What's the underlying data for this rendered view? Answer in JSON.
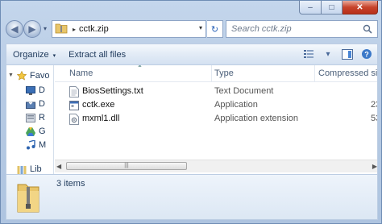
{
  "window": {
    "min_glyph": "–",
    "max_glyph": "□",
    "close_glyph": "✕"
  },
  "nav": {
    "back_glyph": "◀",
    "forward_glyph": "▶",
    "recent_glyph": "▾",
    "breadcrumb": [
      "cctk.zip"
    ],
    "crumb_separator": "▸",
    "dropdown_glyph": "▾",
    "refresh_glyph": "↻",
    "search_placeholder": "Search cctk.zip"
  },
  "toolbar": {
    "organize_label": "Organize",
    "extract_label": "Extract all files",
    "caret": "▾"
  },
  "navpane": {
    "items": [
      {
        "label": "Favo",
        "icon": "star-icon"
      },
      {
        "label": "D",
        "icon": "desktop-icon"
      },
      {
        "label": "D",
        "icon": "downloads-icon"
      },
      {
        "label": "R",
        "icon": "recent-places-icon"
      },
      {
        "label": "G",
        "icon": "google-drive-icon"
      },
      {
        "label": "M",
        "icon": "music-icon"
      },
      {
        "label": "Lib",
        "icon": "library-icon"
      }
    ]
  },
  "columns": {
    "name": "Name",
    "type": "Type",
    "size": "Compressed size"
  },
  "files": [
    {
      "name": "BiosSettings.txt",
      "type": "Text Document",
      "size": "",
      "icon": "text-file-icon"
    },
    {
      "name": "cctk.exe",
      "type": "Application",
      "size": "23",
      "icon": "exe-file-icon"
    },
    {
      "name": "mxml1.dll",
      "type": "Application extension",
      "size": "53",
      "icon": "dll-file-icon"
    }
  ],
  "status": {
    "item_count": "3 items"
  },
  "colors": {
    "accent": "#1e395b",
    "frame": "#b7cbe4",
    "close": "#c7432b"
  }
}
